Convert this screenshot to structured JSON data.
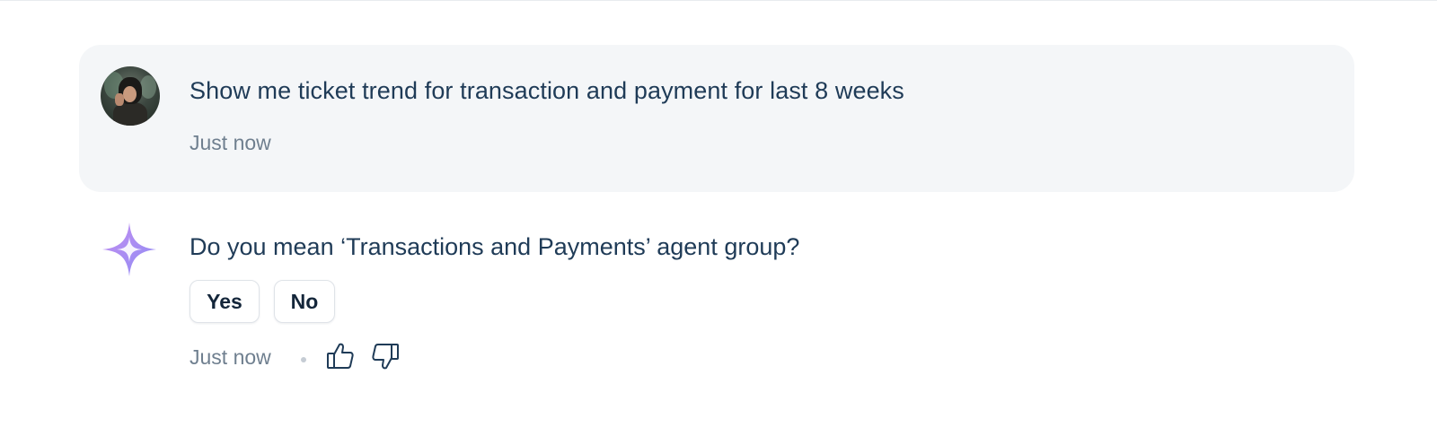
{
  "conversation": {
    "user_message": {
      "text": "Show me ticket trend for transaction and payment for last 8 weeks",
      "timestamp": "Just now",
      "avatar": "user-avatar-photo"
    },
    "assistant_message": {
      "text": "Do you mean ‘Transactions and Payments’ agent group?",
      "icon": "sparkle-icon",
      "options": [
        {
          "label": "Yes"
        },
        {
          "label": "No"
        }
      ],
      "timestamp": "Just now",
      "feedback": {
        "like_icon": "thumbs-up-icon",
        "dislike_icon": "thumbs-down-icon"
      }
    }
  },
  "colors": {
    "text_primary": "#1f3b57",
    "text_muted": "#6f7f8f",
    "bubble_bg": "#f4f6f8",
    "sparkle_gradient_start": "#c48ef0",
    "sparkle_gradient_end": "#8f8cf5"
  }
}
